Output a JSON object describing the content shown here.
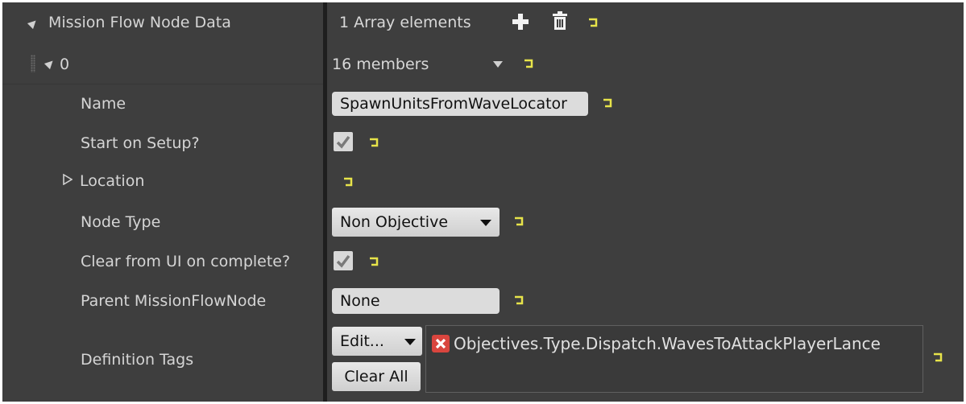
{
  "root": {
    "label": "Mission Flow Node Data",
    "value": "1 Array elements"
  },
  "element": {
    "index": "0",
    "value": "16 members"
  },
  "properties": {
    "name": {
      "label": "Name",
      "value": "SpawnUnitsFromWaveLocator"
    },
    "start_on_setup": {
      "label": "Start on Setup?",
      "checked": true
    },
    "location": {
      "label": "Location"
    },
    "node_type": {
      "label": "Node Type",
      "value": "Non Objective"
    },
    "clear_from_ui": {
      "label": "Clear from UI on complete?",
      "checked": true
    },
    "parent_node": {
      "label": "Parent MissionFlowNode",
      "value": "None"
    },
    "definition_tags": {
      "label": "Definition Tags",
      "edit_label": "Edit...",
      "clear_label": "Clear All",
      "tags": [
        "Objectives.Type.Dispatch.WavesToAttackPlayerLance"
      ]
    }
  },
  "icons": {
    "add": "plus-icon",
    "delete": "trash-icon",
    "reset": "reset-to-default-icon",
    "remove_tag": "x-icon",
    "checkbox": "checkmark-icon"
  },
  "colors": {
    "panel_bg": "#3e3e3e",
    "divider": "#1e1e1e",
    "text": "#d5d5d5",
    "field_bg": "#dcdcdc",
    "reset_yellow": "#e7e34a",
    "tag_remove": "#d9453e"
  }
}
